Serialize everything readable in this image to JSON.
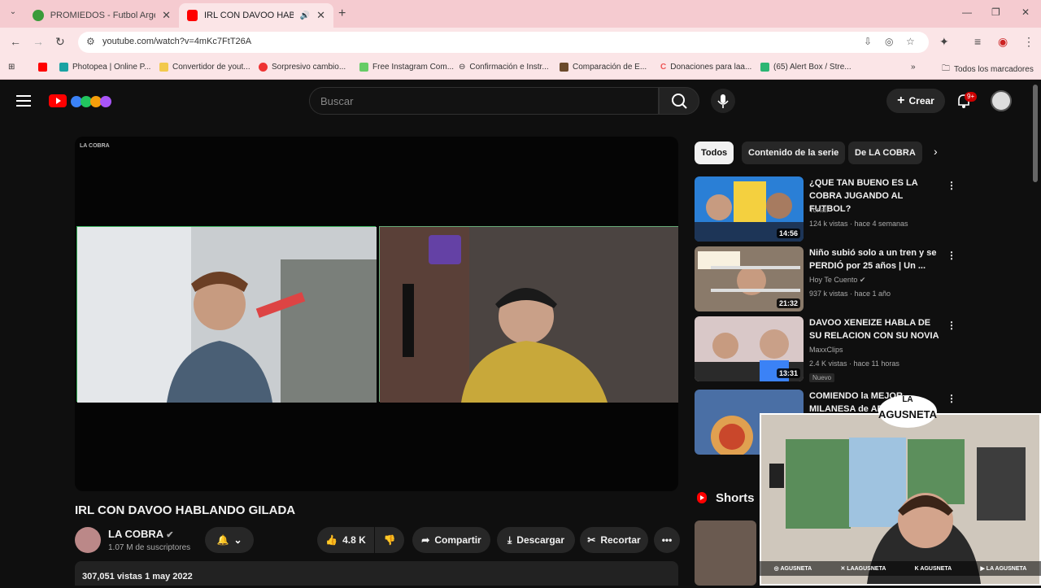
{
  "browser": {
    "tabs": [
      {
        "title": "PROMIEDOS - Futbol Argentino",
        "active": false
      },
      {
        "title": "IRL CON DAVOO HABLANDO",
        "active": true
      }
    ],
    "url": "youtube.com/watch?v=4mKc7FtT26A",
    "bookmarks": [
      "Photopea | Online P...",
      "Convertidor de yout...",
      "Sorpresivo cambio...",
      "Free Instagram Com...",
      "Confirmación e Instr...",
      "Comparación de E...",
      "Donaciones para laa...",
      "(65) Alert Box / Stre...",
      "Todos los marcadores"
    ]
  },
  "header": {
    "search_placeholder": "Buscar",
    "create_label": "Crear",
    "notifications_badge": "9+"
  },
  "video": {
    "watermark": "LA COBRA",
    "title": "IRL CON DAVOO HABLANDO GILADA",
    "channel": "LA COBRA",
    "subscribers": "1.07 M de suscriptores",
    "likes": "4.8 K",
    "share_label": "Compartir",
    "download_label": "Descargar",
    "clip_label": "Recortar",
    "views_date": "307,051 vistas  1 may 2022"
  },
  "chips": [
    "Todos",
    "Contenido de la serie",
    "De LA COBRA"
  ],
  "recommendations": [
    {
      "title": "¿QUE TAN BUENO ES LA COBRA JUGANDO AL FUTBOL?",
      "channel": "Tonali",
      "meta": "124 k vistas · hace 4 semanas",
      "duration": "14:56",
      "badge": ""
    },
    {
      "title": "Niño subió solo a un tren y se PERDIÓ por 25 años | Un ...",
      "channel": "Hoy Te Cuento",
      "meta": "937 k vistas · hace 1 año",
      "duration": "21:32",
      "badge": ""
    },
    {
      "title": "DAVOO XENEIZE HABLA DE SU RELACION CON SU NOVIA",
      "channel": "MaxxClips",
      "meta": "2.4 K vistas · hace 11 horas",
      "duration": "13:31",
      "badge": "Nuevo"
    },
    {
      "title": "COMIENDO la MEJOR MILANESA de AR...",
      "channel": "",
      "meta": "",
      "duration": "",
      "badge": ""
    }
  ],
  "shorts_label": "Shorts",
  "overlay": {
    "logo_text": "LA AGUSNETA",
    "socials": [
      "AGUSNETA",
      "LAAGUSNETA",
      "AGUSNETA",
      "LA AGUSNETA"
    ]
  }
}
